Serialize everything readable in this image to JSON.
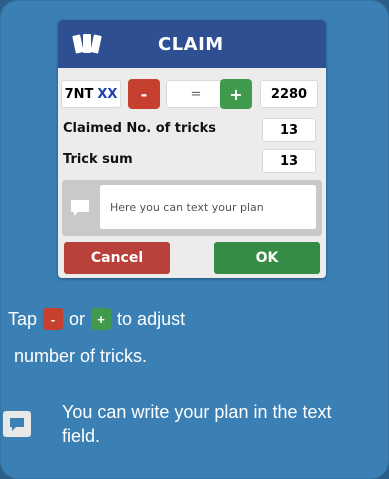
{
  "dialog": {
    "title": "CLAIM",
    "contract_level": "7NT",
    "contract_doubling": "XX",
    "minus_label": "-",
    "equal_label": "=",
    "plus_label": "+",
    "score": "2280",
    "claimed_label": "Claimed No. of tricks",
    "claimed_value": "13",
    "trick_sum_label": "Trick sum",
    "trick_sum_value": "13",
    "plan_placeholder": "Here you can text your plan",
    "cancel_label": "Cancel",
    "ok_label": "OK"
  },
  "help": {
    "tap_prefix": "Tap",
    "minus_label": "-",
    "or_text": "or",
    "plus_label": "+",
    "suffix": "to  adjust",
    "line2": "number of tricks.",
    "plan_text": "You can write your plan in the text field."
  },
  "colors": {
    "header": "#2f4f93",
    "minus": "#c5402e",
    "plus": "#3f9a4b",
    "cancel": "#b8423a",
    "ok": "#358c45",
    "panel": "#3a80b5"
  }
}
